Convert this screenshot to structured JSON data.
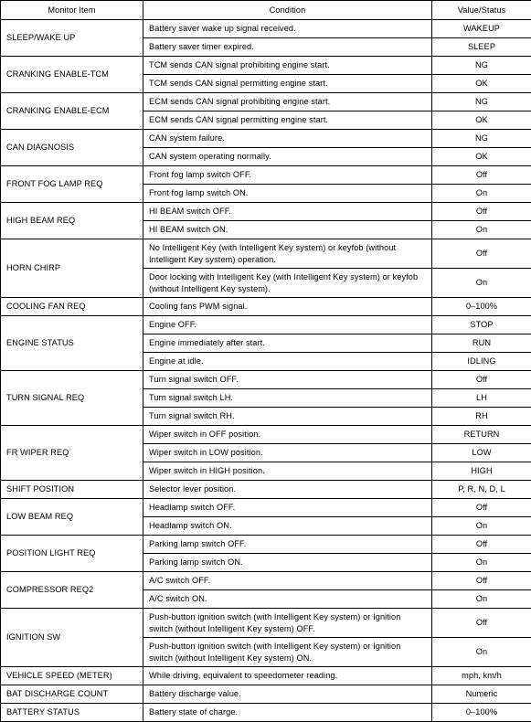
{
  "table": {
    "headers": {
      "monitor_item": "Monitor Item",
      "condition": "Condition",
      "value_status": "Value/Status"
    },
    "groups": [
      {
        "item": "SLEEP/WAKE UP",
        "rows": [
          {
            "condition": "Battery saver wake up signal received.",
            "value": "WAKEUP",
            "lines": 1
          },
          {
            "condition": "Battery saver timer expired.",
            "value": "SLEEP",
            "lines": 1
          }
        ]
      },
      {
        "item": "CRANKING ENABLE-TCM",
        "rows": [
          {
            "condition": "TCM sends CAN signal prohibiting engine start.",
            "value": "NG",
            "lines": 1
          },
          {
            "condition": "TCM sends CAN signal permitting engine start.",
            "value": "OK",
            "lines": 1
          }
        ]
      },
      {
        "item": "CRANKING ENABLE-ECM",
        "rows": [
          {
            "condition": "ECM sends CAN signal prohibiting engine start.",
            "value": "NG",
            "lines": 1
          },
          {
            "condition": "ECM sends CAN signal permitting engine start.",
            "value": "OK",
            "lines": 1
          }
        ]
      },
      {
        "item": "CAN DIAGNOSIS",
        "rows": [
          {
            "condition": "CAN system failure.",
            "value": "NG",
            "lines": 1
          },
          {
            "condition": "CAN system operating normally.",
            "value": "OK",
            "lines": 1
          }
        ]
      },
      {
        "item": "FRONT FOG LAMP REQ",
        "rows": [
          {
            "condition": "Front fog lamp switch OFF.",
            "value": "Off",
            "lines": 1
          },
          {
            "condition": "Front fog lamp switch ON.",
            "value": "On",
            "lines": 1
          }
        ]
      },
      {
        "item": "HIGH BEAM REQ",
        "rows": [
          {
            "condition": "HI BEAM switch OFF.",
            "value": "Off",
            "lines": 1
          },
          {
            "condition": "HI BEAM switch ON.",
            "value": "On",
            "lines": 1
          }
        ]
      },
      {
        "item": "HORN CHIRP",
        "rows": [
          {
            "condition": "No Intelligent Key (with Intelligent Key system) or keyfob (without Intelligent Key system) operation.",
            "value": "Off",
            "lines": 2
          },
          {
            "condition": "Door locking with Intelligent Key (with Intelligent Key system) or keyfob (without Intelligent Key system).",
            "value": "On",
            "lines": 2
          }
        ]
      },
      {
        "item": "COOLING FAN REQ",
        "rows": [
          {
            "condition": "Cooling fans PWM signal.",
            "value": "0–100%",
            "lines": 1
          }
        ]
      },
      {
        "item": "ENGINE STATUS",
        "rows": [
          {
            "condition": "Engine OFF.",
            "value": "STOP",
            "lines": 1
          },
          {
            "condition": "Engine immediately after start.",
            "value": "RUN",
            "lines": 1
          },
          {
            "condition": "Engine at idle.",
            "value": "IDLING",
            "lines": 1
          }
        ]
      },
      {
        "item": "TURN SIGNAL REQ",
        "rows": [
          {
            "condition": "Turn signal switch OFF.",
            "value": "Off",
            "lines": 1
          },
          {
            "condition": "Turn signal switch LH.",
            "value": "LH",
            "lines": 1
          },
          {
            "condition": "Turn signal switch RH.",
            "value": "RH",
            "lines": 1
          }
        ]
      },
      {
        "item": "FR WIPER REQ",
        "rows": [
          {
            "condition": "Wiper switch in OFF position.",
            "value": "RETURN",
            "lines": 1
          },
          {
            "condition": "Wiper switch in LOW position.",
            "value": "LOW",
            "lines": 1
          },
          {
            "condition": "Wiper switch in HIGH position.",
            "value": "HIGH",
            "lines": 1
          }
        ]
      },
      {
        "item": "SHIFT POSITION",
        "rows": [
          {
            "condition": "Selector lever position.",
            "value": "P, R, N, D, L",
            "lines": 1
          }
        ]
      },
      {
        "item": "LOW BEAM REQ",
        "rows": [
          {
            "condition": "Headlamp switch OFF.",
            "value": "Off",
            "lines": 1
          },
          {
            "condition": "Headlamp switch ON.",
            "value": "On",
            "lines": 1
          }
        ]
      },
      {
        "item": "POSITION LIGHT REQ",
        "rows": [
          {
            "condition": "Parking lamp switch OFF.",
            "value": "Off",
            "lines": 1
          },
          {
            "condition": "Parking lamp switch ON.",
            "value": "On",
            "lines": 1
          }
        ]
      },
      {
        "item": "COMPRESSOR REQ2",
        "rows": [
          {
            "condition": "A/C switch OFF.",
            "value": "Off",
            "lines": 1
          },
          {
            "condition": "A/C switch ON.",
            "value": "On",
            "lines": 1
          }
        ]
      },
      {
        "item": "IGNITION SW",
        "rows": [
          {
            "condition": "Push-button ignition switch (with Intelligent Key system) or Ignition switch (without Intelligent Key system) OFF.",
            "value": "Off",
            "lines": 2
          },
          {
            "condition": "Push-button ignition switch (with Intelligent Key system) or Ignition switch (without Intelligent Key system) ON.",
            "value": "On",
            "lines": 2
          }
        ]
      },
      {
        "item": "VEHICLE SPEED (METER)",
        "rows": [
          {
            "condition": "While driving, equivalent to speedometer reading.",
            "value": "mph, km/h",
            "lines": 1
          }
        ]
      },
      {
        "item": "BAT DISCHARGE COUNT",
        "rows": [
          {
            "condition": "Battery discharge value.",
            "value": "Numeric",
            "lines": 1
          }
        ]
      },
      {
        "item": "BATTERY STATUS",
        "rows": [
          {
            "condition": "Battery state of charge.",
            "value": "0–100%",
            "lines": 1
          }
        ]
      }
    ]
  }
}
